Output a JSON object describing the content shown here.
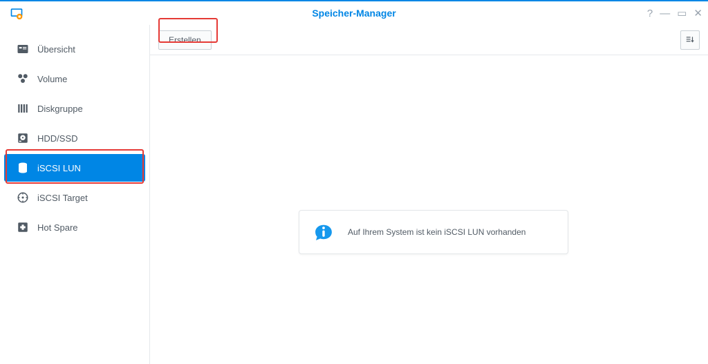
{
  "window": {
    "title": "Speicher-Manager"
  },
  "sidebar": {
    "items": [
      {
        "label": "Übersicht"
      },
      {
        "label": "Volume"
      },
      {
        "label": "Diskgruppe"
      },
      {
        "label": "HDD/SSD"
      },
      {
        "label": "iSCSI LUN"
      },
      {
        "label": "iSCSI Target"
      },
      {
        "label": "Hot Spare"
      }
    ]
  },
  "toolbar": {
    "create_label": "Erstellen"
  },
  "info": {
    "message": "Auf Ihrem System ist kein iSCSI LUN vorhanden"
  }
}
